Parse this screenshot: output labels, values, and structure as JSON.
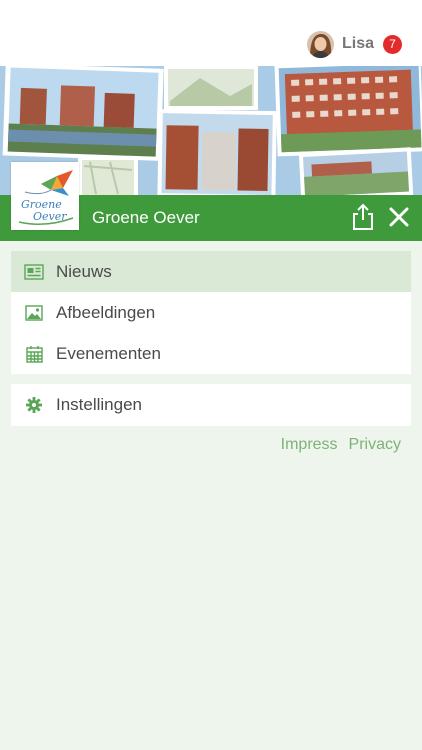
{
  "user": {
    "name": "Lisa",
    "notification_count": "7"
  },
  "header": {
    "title": "Groene Oever",
    "share_icon": "share-icon",
    "close_icon": "close-icon"
  },
  "logo": {
    "line1": "Groene",
    "line2": "Oever"
  },
  "menu": {
    "primary": [
      {
        "label": "Nieuws",
        "icon": "newspaper-icon",
        "active": true
      },
      {
        "label": "Afbeeldingen",
        "icon": "image-icon",
        "active": false
      },
      {
        "label": "Evenementen",
        "icon": "calendar-icon",
        "active": false
      }
    ],
    "secondary": [
      {
        "label": "Instellingen",
        "icon": "gear-icon",
        "active": false
      }
    ]
  },
  "footer": {
    "impress": "Impress",
    "privacy": "Privacy"
  },
  "colors": {
    "brand_green": "#3f9a3c",
    "icon_green": "#5aa556",
    "active_bg": "#d9e9d6",
    "page_bg": "#eef5ec",
    "badge_red": "#e32b2b"
  }
}
